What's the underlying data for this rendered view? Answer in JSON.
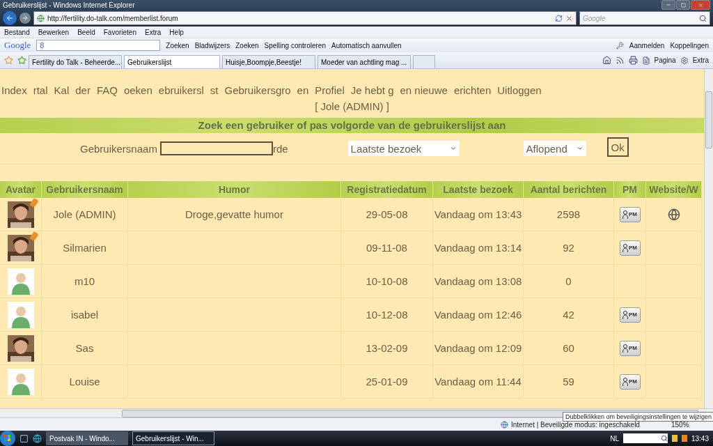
{
  "window": {
    "title": "Gebruikerslijst - Windows Internet Explorer"
  },
  "address_bar": {
    "url": "http://fertility.do-talk.com/memberlist.forum"
  },
  "search_box": {
    "placeholder": "Google"
  },
  "menu": [
    "Bestand",
    "Bewerken",
    "Beeld",
    "Favorieten",
    "Extra",
    "Help"
  ],
  "google_toolbar": {
    "logo": "Google",
    "search_value": "8",
    "buttons": [
      "Zoeken",
      "Bladwijzers",
      "Zoeken",
      "Spelling controleren",
      "Automatisch aanvullen"
    ],
    "right_buttons": [
      "Aanmelden",
      "Koppelingen"
    ]
  },
  "tabs": [
    {
      "label": "Fertility do Talk - Beheerde...",
      "selected": false
    },
    {
      "label": "Gebruikerslijst",
      "selected": true
    },
    {
      "label": "Huisje,Boompje,Beestje!",
      "selected": false
    },
    {
      "label": "Moeder van achtling mag ...",
      "selected": false
    }
  ],
  "command_bar": [
    "Pagina",
    "Extra"
  ],
  "page": {
    "nav_links": [
      "Index",
      "rtal",
      "Kal",
      "der",
      "FAQ",
      "oeken",
      "ebruikersl",
      "st",
      "Gebruikersgro",
      "en",
      "Profiel",
      "Je hebt g",
      "en nieuwe",
      "erichten",
      "Uitloggen"
    ],
    "user_label": "[ Jole (ADMIN) ]",
    "search_heading": "Zoek een gebruiker of pas volgorde van de gebruikerslijst aan",
    "form": {
      "username_label": "Gebruikersnaam",
      "field_suffix": "rde",
      "sort_select": "Laatste bezoek",
      "order_select": "Aflopend",
      "submit": "Ok"
    },
    "table": {
      "columns": [
        "Avatar",
        "Gebruikersnaam",
        "Humor",
        "Registratiedatum",
        "Laatste bezoek",
        "Aantal berichten",
        "PM",
        "Website/W"
      ],
      "rows": [
        {
          "badge": true,
          "name": "Jole (ADMIN)",
          "humor": "Droge,gevatte humor",
          "registered": "29-05-08",
          "last_visit": "Vandaag om 13:43",
          "posts": "2598",
          "pm": "PM",
          "website": true
        },
        {
          "badge": true,
          "name": "Silmarien",
          "registered": "09-11-08",
          "last_visit": "Vandaag om 13:14",
          "posts": "92",
          "pm": "PM",
          "website": false
        },
        {
          "kind": "default",
          "badge": false,
          "name": "m10",
          "registered": "10-10-08",
          "last_visit": "Vandaag om 13:08",
          "posts": "0",
          "website": false
        },
        {
          "kind": "default",
          "badge": false,
          "name": "isabel",
          "registered": "10-12-08",
          "last_visit": "Vandaag om 12:46",
          "posts": "42",
          "pm": "PM",
          "website": false
        },
        {
          "badge": false,
          "name": "Sas",
          "registered": "13-02-09",
          "last_visit": "Vandaag om 12:09",
          "posts": "60",
          "pm": "PM",
          "website": false
        },
        {
          "kind": "default",
          "badge": false,
          "name": "Louise",
          "registered": "25-01-09",
          "last_visit": "Vandaag om 11:44",
          "posts": "59",
          "pm": "PM",
          "website": false
        }
      ]
    }
  },
  "status_bar": {
    "zone": "Internet | Beveiligde modus: ingeschakeld",
    "zoom": "150%",
    "tooltip": "Dubbelklikken om beveiligingsinstellingen te wijzigen"
  },
  "taskbar": {
    "tasks": [
      {
        "label": "Postvak IN - Windo...",
        "selected": false
      },
      {
        "label": "Gebruikerslijst - Win...",
        "selected": true
      }
    ],
    "language": "NL",
    "clock": "13:43"
  }
}
